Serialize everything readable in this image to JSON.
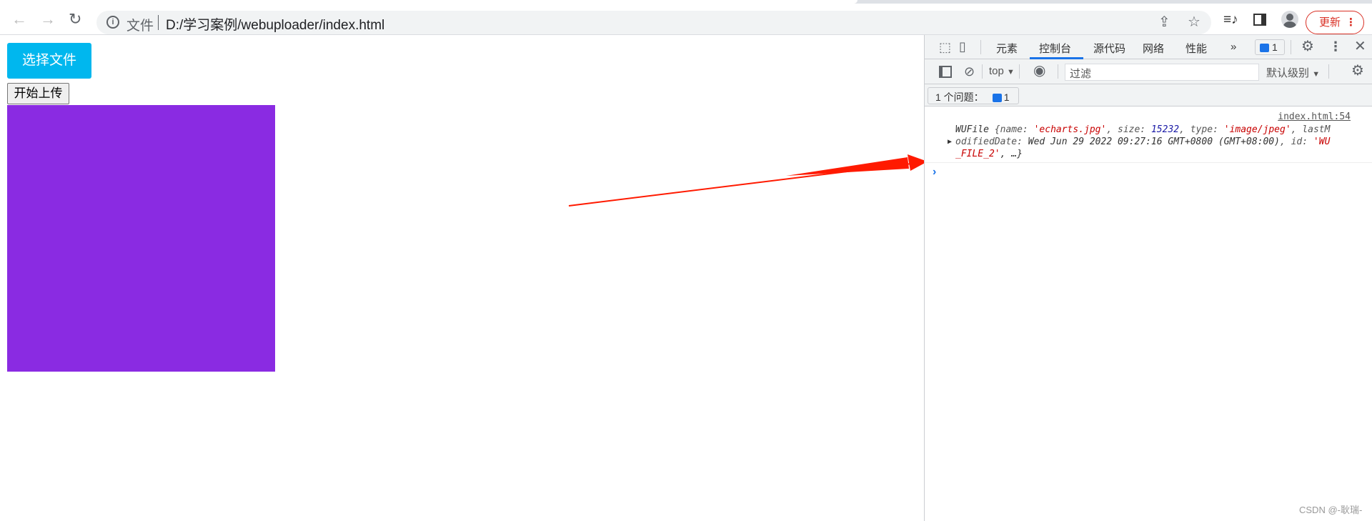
{
  "browser": {
    "scheme_label": "文件",
    "url": "D:/学习案例/webuploader/index.html",
    "update_label": "更新",
    "icons": [
      "back-icon",
      "forward-icon",
      "reload-icon",
      "info-icon",
      "share-icon",
      "star-icon",
      "media-icon",
      "side-panel-icon",
      "profile-icon",
      "more-icon"
    ]
  },
  "page": {
    "choose_button": "选择文件",
    "upload_button": "开始上传",
    "preview_color": "#8a2be2",
    "choose_color": "#00b7ee"
  },
  "devtools": {
    "tabs": [
      "元素",
      "控制台",
      "源代码",
      "网络",
      "性能"
    ],
    "active_tab": "控制台",
    "more": "»",
    "issue_count": "1",
    "context": "top",
    "filter_placeholder": "过滤",
    "level": "默认级别",
    "issues_label": "1 个问题：",
    "issues_count": "1",
    "console": {
      "source": "index.html:54",
      "line1": {
        "cls": "WUFile ",
        "p1": "{name: ",
        "v1": "'echarts.jpg'",
        "p2": ", size: ",
        "v2": "15232",
        "p3": ", type: ",
        "v3": "'image/jpeg'",
        "p4": ", lastM"
      },
      "line2": {
        "p1": "odifiedDate: ",
        "v1": "Wed Jun 29 2022 09:27:16 GMT+0800 (GMT+08:00)",
        "p2": ", id: ",
        "v2": "'WU"
      },
      "line3": {
        "v1": "_FILE_2'",
        "p1": ", …}"
      },
      "prompt": "›"
    }
  },
  "annotation": {
    "arrow_color": "#ff0000"
  },
  "watermark": "CSDN @-耿瑞-"
}
